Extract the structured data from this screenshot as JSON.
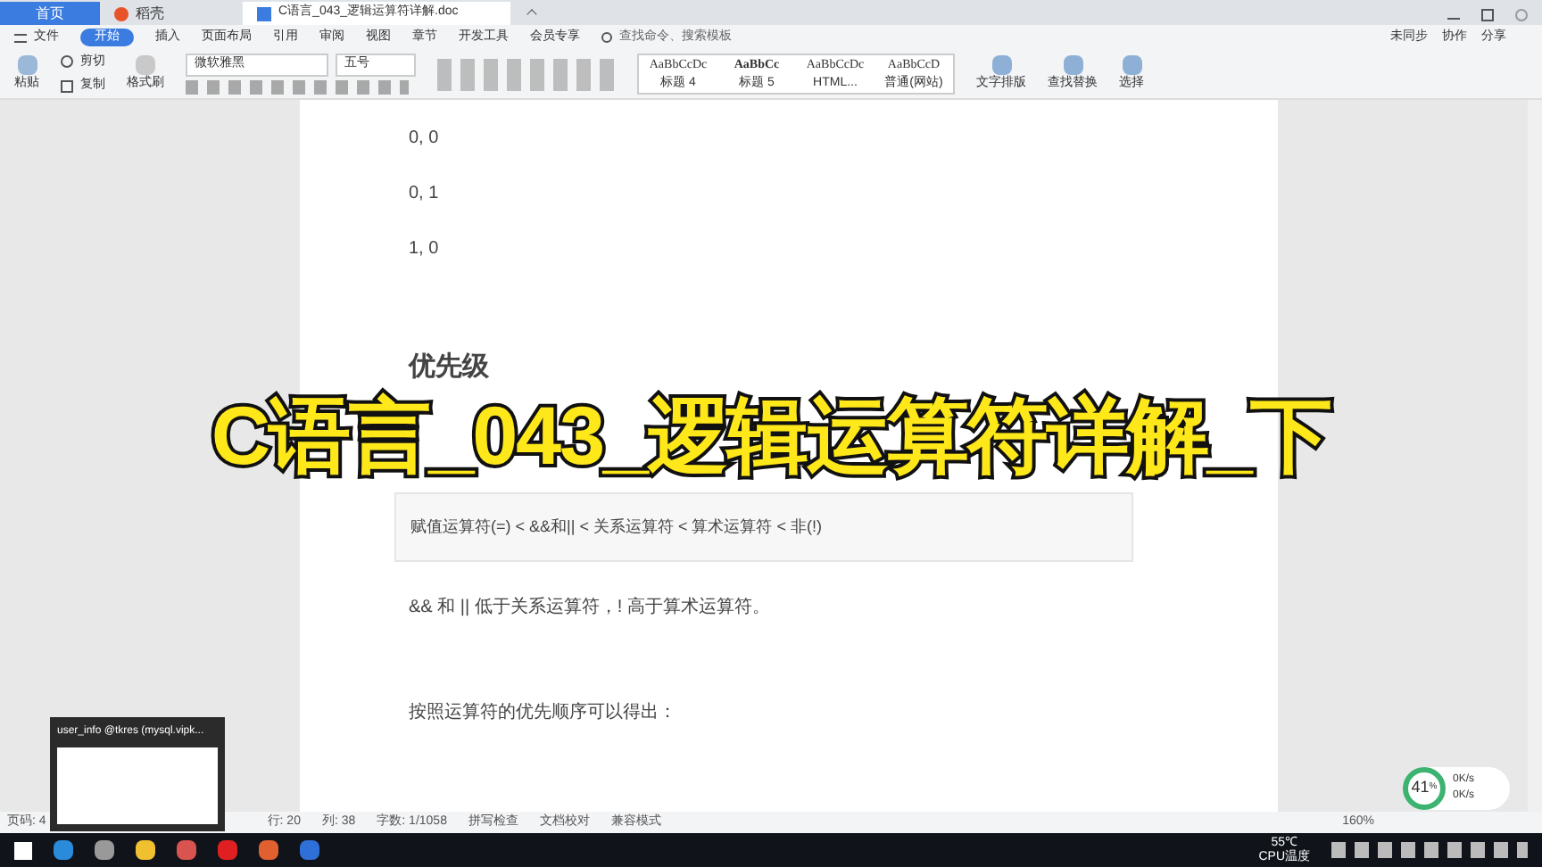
{
  "tabs": [
    {
      "label": "首页",
      "kind": "home",
      "selected": false
    },
    {
      "label": "稻壳",
      "kind": "shell",
      "selected": false
    },
    {
      "label": "C语言_043_逻辑运算符详解.doc",
      "kind": "doc",
      "selected": true
    }
  ],
  "menu": {
    "file": "文件",
    "items": [
      {
        "label": "开始",
        "selected": true
      },
      {
        "label": "插入",
        "selected": false
      },
      {
        "label": "页面布局",
        "selected": false
      },
      {
        "label": "引用",
        "selected": false
      },
      {
        "label": "审阅",
        "selected": false
      },
      {
        "label": "视图",
        "selected": false
      },
      {
        "label": "章节",
        "selected": false
      },
      {
        "label": "开发工具",
        "selected": false
      },
      {
        "label": "会员专享",
        "selected": false
      }
    ],
    "search": "查找命令、搜索模板",
    "right": [
      "未同步",
      "协作",
      "分享"
    ]
  },
  "ribbon": {
    "paste": "粘贴",
    "cut": "剪切",
    "copy": "复制",
    "format_painter": "格式刷",
    "font": "微软雅黑",
    "size": "五号",
    "styles": [
      {
        "sample": "AaBbCcDc",
        "name": "标题 4"
      },
      {
        "sample": "AaBbCc",
        "name": "标题 5"
      },
      {
        "sample": "AaBbCcDc",
        "name": "HTML..."
      },
      {
        "sample": "AaBbCcD",
        "name": "普通(网站)"
      }
    ],
    "tools": [
      "文字排版",
      "查找替换",
      "选择"
    ]
  },
  "document": {
    "blocks": [
      {
        "kind": "para",
        "text": "0, 0"
      },
      {
        "kind": "para",
        "text": "0, 1"
      },
      {
        "kind": "para",
        "text": "1, 0"
      },
      {
        "kind": "heading",
        "text": "优先级"
      },
      {
        "kind": "code",
        "text": "赋值运算符(=) < &&和|| < 关系运算符  <  算术运算符  <  非(!)"
      },
      {
        "kind": "para",
        "text": "&&  和  ||  低于关系运算符，!  高于算术运算符。"
      },
      {
        "kind": "para",
        "text": "按照运算符的优先顺序可以得出："
      }
    ]
  },
  "banner": "C语言_043_逻辑运算符详解_下",
  "status_bar": {
    "items": [
      "页码: 4",
      "行: 20",
      "列: 38",
      "字数: 1/1058",
      "拼写检查",
      "文档校对",
      "兼容模式"
    ],
    "zoom": "160%"
  },
  "thumbnail": {
    "title": "user_info @tkres (mysql.vipk..."
  },
  "network": {
    "percent": "41",
    "unit": "%",
    "up": "0K/s",
    "down": "0K/s"
  },
  "tray": {
    "temp": "55℃",
    "label": "CPU温度"
  }
}
